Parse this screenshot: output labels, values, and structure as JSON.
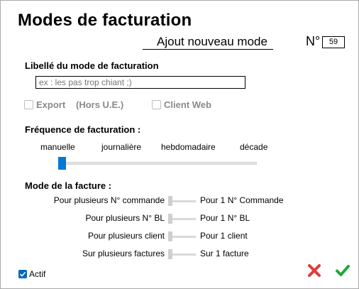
{
  "title": "Modes de facturation",
  "subtitle": "Ajout nouveau mode",
  "number": {
    "label": "N°",
    "value": "59"
  },
  "libelle": {
    "section": "Libellé du mode de facturation",
    "placeholder": "ex : les pas trop chiant ;)"
  },
  "options": {
    "export_label": "Export",
    "hors_ue": "(Hors U.E.)",
    "client_web_label": "Client Web"
  },
  "frequence": {
    "section": "Fréquence de facturation :",
    "labels": [
      "manuelle",
      "journalière",
      "hebdomadaire",
      "décade"
    ],
    "selected": "manuelle"
  },
  "mode_facture": {
    "section": "Mode de la facture :",
    "rows": [
      {
        "left": "Pour plusieurs N° commande",
        "right": "Pour 1 N° Commande"
      },
      {
        "left": "Pour plusieurs N° BL",
        "right": "Pour 1 N° BL"
      },
      {
        "left": "Pour plusieurs client",
        "right": "Pour 1 client"
      },
      {
        "left": "Sur plusieurs factures",
        "right": "Sur 1 facture"
      }
    ]
  },
  "actif": {
    "label": "Actif",
    "checked": true
  },
  "colors": {
    "accent": "#0078d7",
    "cancel": "#e03a3a",
    "validate": "#22a83a"
  },
  "icons": {
    "cancel": "close-icon",
    "validate": "check-icon"
  }
}
